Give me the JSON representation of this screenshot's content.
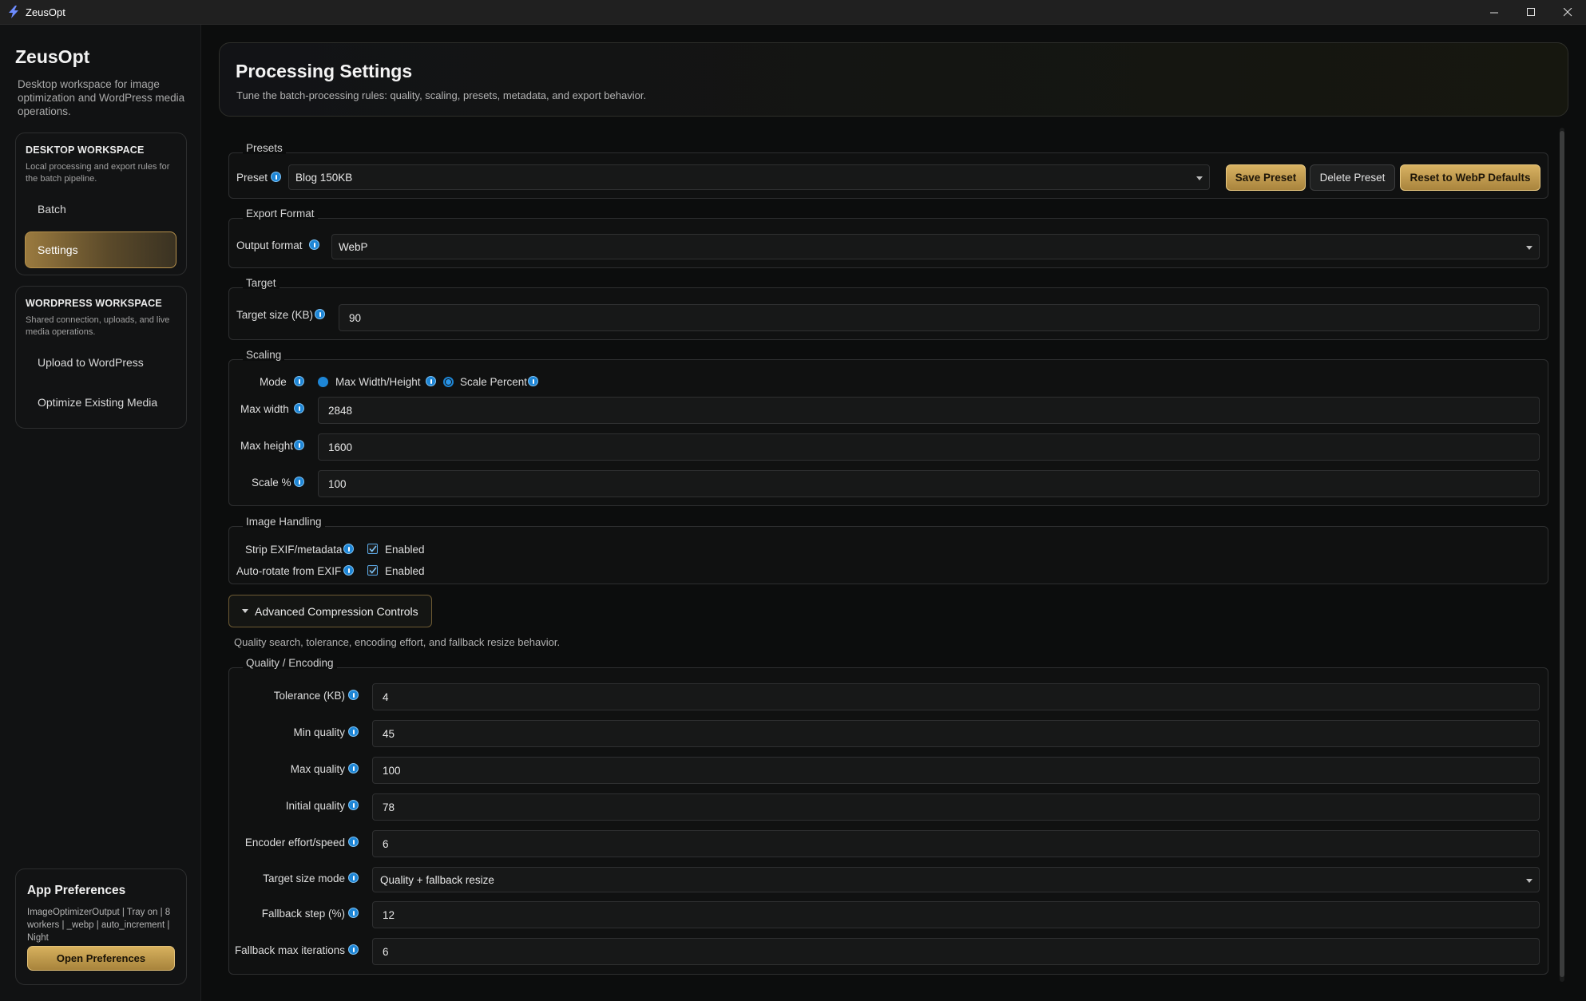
{
  "window": {
    "title": "ZeusOpt"
  },
  "sidebar": {
    "brand": "ZeusOpt",
    "brand_sub": "Desktop workspace for image optimization and WordPress media operations.",
    "desktop": {
      "heading": "DESKTOP WORKSPACE",
      "sub": "Local processing and export rules for the batch pipeline.",
      "items": [
        {
          "label": "Batch"
        },
        {
          "label": "Settings"
        }
      ]
    },
    "wordpress": {
      "heading": "WORDPRESS WORKSPACE",
      "sub": "Shared connection, uploads, and live media operations.",
      "items": [
        {
          "label": "Upload to WordPress"
        },
        {
          "label": "Optimize Existing Media"
        }
      ]
    },
    "prefs": {
      "title": "App Preferences",
      "summary": "ImageOptimizerOutput | Tray on | 8 workers | _webp | auto_increment | Night",
      "button": "Open Preferences"
    }
  },
  "header": {
    "title": "Processing Settings",
    "subtitle": "Tune the batch-processing rules: quality, scaling, presets, metadata, and export behavior."
  },
  "presets": {
    "group": "Presets",
    "label": "Preset",
    "value": "Blog 150KB",
    "save": "Save Preset",
    "delete": "Delete Preset",
    "reset": "Reset to WebP Defaults"
  },
  "export": {
    "group": "Export Format",
    "label": "Output format",
    "value": "WebP"
  },
  "target": {
    "group": "Target",
    "label": "Target size (KB)",
    "value": "90"
  },
  "scaling": {
    "group": "Scaling",
    "mode_label": "Mode",
    "option_max": "Max Width/Height",
    "option_scale": "Scale Percent",
    "max_width_label": "Max width",
    "max_width": "2848",
    "max_height_label": "Max height",
    "max_height": "1600",
    "scale_label": "Scale %",
    "scale": "100"
  },
  "handling": {
    "group": "Image Handling",
    "strip_label": "Strip EXIF/metadata",
    "strip_value": "Enabled",
    "rotate_label": "Auto-rotate from EXIF",
    "rotate_value": "Enabled"
  },
  "advanced": {
    "toggle": "Advanced Compression Controls",
    "note": "Quality search, tolerance, encoding effort, and fallback resize behavior."
  },
  "quality": {
    "group": "Quality / Encoding",
    "rows": [
      {
        "label": "Tolerance (KB)",
        "value": "4"
      },
      {
        "label": "Min quality",
        "value": "45"
      },
      {
        "label": "Max quality",
        "value": "100"
      },
      {
        "label": "Initial quality",
        "value": "78"
      },
      {
        "label": "Encoder effort/speed",
        "value": "6"
      },
      {
        "label": "Target size mode",
        "value": "Quality + fallback resize"
      },
      {
        "label": "Fallback step (%)",
        "value": "12"
      },
      {
        "label": "Fallback max iterations",
        "value": "6"
      }
    ]
  },
  "colors": {
    "accent": "#c9a24f",
    "info": "#1e86d6",
    "background": "#0c0d0d"
  }
}
